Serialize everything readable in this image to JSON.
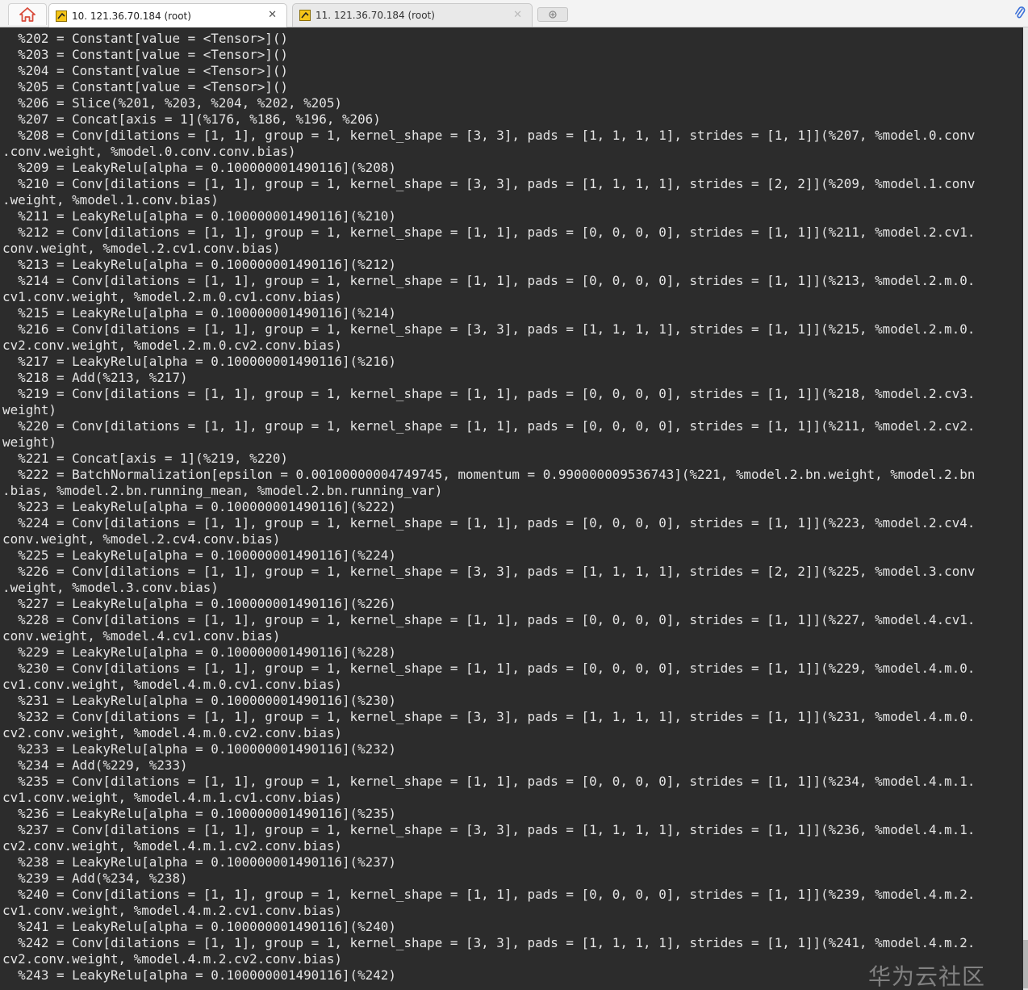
{
  "tabs": [
    {
      "label": "10. 121.36.70.184 (root)",
      "active": true,
      "close": "✕"
    },
    {
      "label": "11. 121.36.70.184 (root)",
      "active": false,
      "close": "✕"
    }
  ],
  "icons": {
    "home": "home-icon",
    "session": "terminal-session-icon",
    "new_tab": "new-tab-icon",
    "attach": "paperclip-icon"
  },
  "colors": {
    "terminal_bg": "#2c2c2c",
    "terminal_fg": "#e4e4e4",
    "home_icon": "#d94b3b"
  },
  "terminal": {
    "lines": [
      "  %202 = Constant[value = <Tensor>]()",
      "  %203 = Constant[value = <Tensor>]()",
      "  %204 = Constant[value = <Tensor>]()",
      "  %205 = Constant[value = <Tensor>]()",
      "  %206 = Slice(%201, %203, %204, %202, %205)",
      "  %207 = Concat[axis = 1](%176, %186, %196, %206)",
      "  %208 = Conv[dilations = [1, 1], group = 1, kernel_shape = [3, 3], pads = [1, 1, 1, 1], strides = [1, 1]](%207, %model.0.conv",
      ".conv.weight, %model.0.conv.conv.bias)",
      "  %209 = LeakyRelu[alpha = 0.100000001490116](%208)",
      "  %210 = Conv[dilations = [1, 1], group = 1, kernel_shape = [3, 3], pads = [1, 1, 1, 1], strides = [2, 2]](%209, %model.1.conv",
      ".weight, %model.1.conv.bias)",
      "  %211 = LeakyRelu[alpha = 0.100000001490116](%210)",
      "  %212 = Conv[dilations = [1, 1], group = 1, kernel_shape = [1, 1], pads = [0, 0, 0, 0], strides = [1, 1]](%211, %model.2.cv1.",
      "conv.weight, %model.2.cv1.conv.bias)",
      "  %213 = LeakyRelu[alpha = 0.100000001490116](%212)",
      "  %214 = Conv[dilations = [1, 1], group = 1, kernel_shape = [1, 1], pads = [0, 0, 0, 0], strides = [1, 1]](%213, %model.2.m.0.",
      "cv1.conv.weight, %model.2.m.0.cv1.conv.bias)",
      "  %215 = LeakyRelu[alpha = 0.100000001490116](%214)",
      "  %216 = Conv[dilations = [1, 1], group = 1, kernel_shape = [3, 3], pads = [1, 1, 1, 1], strides = [1, 1]](%215, %model.2.m.0.",
      "cv2.conv.weight, %model.2.m.0.cv2.conv.bias)",
      "  %217 = LeakyRelu[alpha = 0.100000001490116](%216)",
      "  %218 = Add(%213, %217)",
      "  %219 = Conv[dilations = [1, 1], group = 1, kernel_shape = [1, 1], pads = [0, 0, 0, 0], strides = [1, 1]](%218, %model.2.cv3.",
      "weight)",
      "  %220 = Conv[dilations = [1, 1], group = 1, kernel_shape = [1, 1], pads = [0, 0, 0, 0], strides = [1, 1]](%211, %model.2.cv2.",
      "weight)",
      "  %221 = Concat[axis = 1](%219, %220)",
      "  %222 = BatchNormalization[epsilon = 0.00100000004749745, momentum = 0.990000009536743](%221, %model.2.bn.weight, %model.2.bn",
      ".bias, %model.2.bn.running_mean, %model.2.bn.running_var)",
      "  %223 = LeakyRelu[alpha = 0.100000001490116](%222)",
      "  %224 = Conv[dilations = [1, 1], group = 1, kernel_shape = [1, 1], pads = [0, 0, 0, 0], strides = [1, 1]](%223, %model.2.cv4.",
      "conv.weight, %model.2.cv4.conv.bias)",
      "  %225 = LeakyRelu[alpha = 0.100000001490116](%224)",
      "  %226 = Conv[dilations = [1, 1], group = 1, kernel_shape = [3, 3], pads = [1, 1, 1, 1], strides = [2, 2]](%225, %model.3.conv",
      ".weight, %model.3.conv.bias)",
      "  %227 = LeakyRelu[alpha = 0.100000001490116](%226)",
      "  %228 = Conv[dilations = [1, 1], group = 1, kernel_shape = [1, 1], pads = [0, 0, 0, 0], strides = [1, 1]](%227, %model.4.cv1.",
      "conv.weight, %model.4.cv1.conv.bias)",
      "  %229 = LeakyRelu[alpha = 0.100000001490116](%228)",
      "  %230 = Conv[dilations = [1, 1], group = 1, kernel_shape = [1, 1], pads = [0, 0, 0, 0], strides = [1, 1]](%229, %model.4.m.0.",
      "cv1.conv.weight, %model.4.m.0.cv1.conv.bias)",
      "  %231 = LeakyRelu[alpha = 0.100000001490116](%230)",
      "  %232 = Conv[dilations = [1, 1], group = 1, kernel_shape = [3, 3], pads = [1, 1, 1, 1], strides = [1, 1]](%231, %model.4.m.0.",
      "cv2.conv.weight, %model.4.m.0.cv2.conv.bias)",
      "  %233 = LeakyRelu[alpha = 0.100000001490116](%232)",
      "  %234 = Add(%229, %233)",
      "  %235 = Conv[dilations = [1, 1], group = 1, kernel_shape = [1, 1], pads = [0, 0, 0, 0], strides = [1, 1]](%234, %model.4.m.1.",
      "cv1.conv.weight, %model.4.m.1.cv1.conv.bias)",
      "  %236 = LeakyRelu[alpha = 0.100000001490116](%235)",
      "  %237 = Conv[dilations = [1, 1], group = 1, kernel_shape = [3, 3], pads = [1, 1, 1, 1], strides = [1, 1]](%236, %model.4.m.1.",
      "cv2.conv.weight, %model.4.m.1.cv2.conv.bias)",
      "  %238 = LeakyRelu[alpha = 0.100000001490116](%237)",
      "  %239 = Add(%234, %238)",
      "  %240 = Conv[dilations = [1, 1], group = 1, kernel_shape = [1, 1], pads = [0, 0, 0, 0], strides = [1, 1]](%239, %model.4.m.2.",
      "cv1.conv.weight, %model.4.m.2.cv1.conv.bias)",
      "  %241 = LeakyRelu[alpha = 0.100000001490116](%240)",
      "  %242 = Conv[dilations = [1, 1], group = 1, kernel_shape = [3, 3], pads = [1, 1, 1, 1], strides = [1, 1]](%241, %model.4.m.2.",
      "cv2.conv.weight, %model.4.m.2.cv2.conv.bias)",
      "  %243 = LeakyRelu[alpha = 0.100000001490116](%242)"
    ]
  },
  "watermark": "华为云社区"
}
